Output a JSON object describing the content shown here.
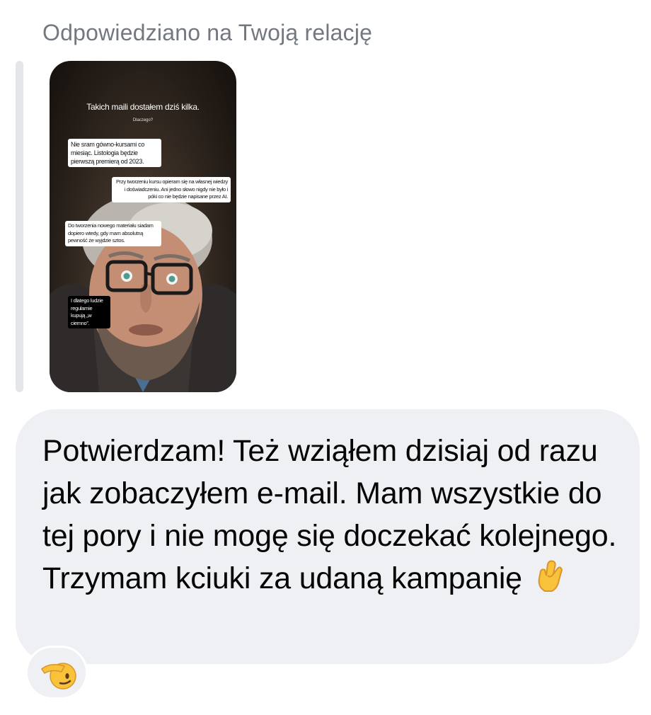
{
  "reply_header": "Odpowiedziano na Twoją relację",
  "story": {
    "title": "Takich maili dostałem dziś kilka.",
    "subtitle": "Dlaczego?",
    "notes": [
      "Nie sram gówno-kursami co miesiąc. Listologia będzie pierwszą premierą od 2023.",
      "Przy tworzeniu kursu opieram się na własnej wiedzy i doświadczeniu. Ani jedno słowo nigdy nie było i póki co nie będzie napisane przez AI.",
      "Do tworzenia nowego materiału siadam dopiero wtedy, gdy mam absolutną pewność że wyjdzie sztos.",
      "I dlatego ludzie regularnie kupują „w ciemno”."
    ]
  },
  "message": {
    "text": "Potwierdzam! Też wziąłem dzisiaj od razu jak zobaczyłem e-mail. Mam wszystkie do tej pory i nie mogę się doczekać kolejnego. Trzymam kciuki za udaną kampanię",
    "emoji": "crossed-fingers-icon"
  },
  "reaction": {
    "emoji": "saluting-face-icon"
  },
  "colors": {
    "bubble_bg": "#eff0f3",
    "header_text": "#737880",
    "quote_bar": "#e4e6ea"
  }
}
